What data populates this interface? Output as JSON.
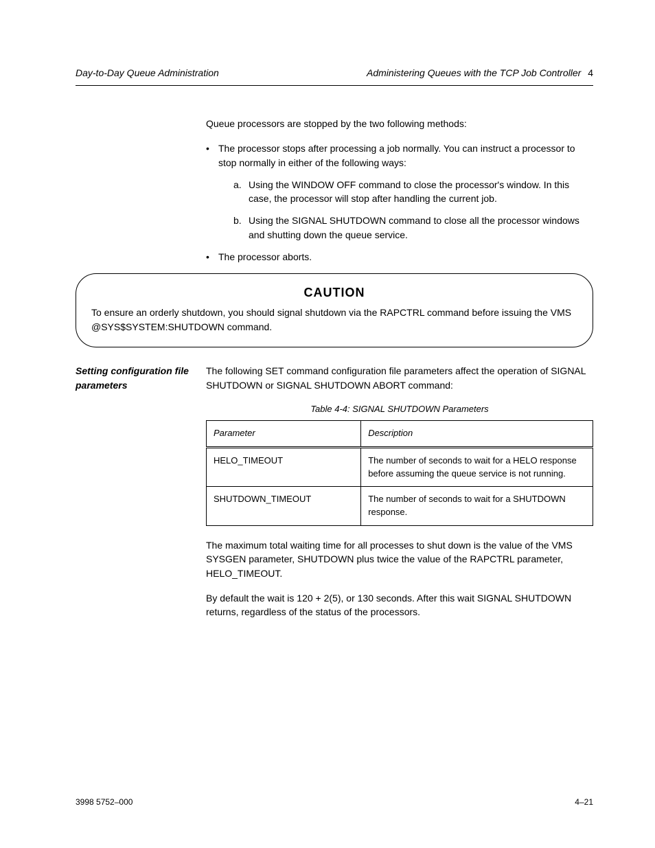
{
  "header": {
    "left": "Day-to-Day Queue Administration",
    "right_italic": "Administering Queues with the TCP Job Controller",
    "right_num": "4"
  },
  "intro": "Queue processors are stopped by the two following methods:",
  "bullets": [
    "The processor stops after processing a job normally. You can instruct a processor to stop normally in either of the following ways:",
    "The processor aborts."
  ],
  "sub_bullets": [
    {
      "mark": "a.",
      "text": "Using the WINDOW OFF command to close the processor's window. In this case, the processor will stop after handling the current job."
    },
    {
      "mark": "b.",
      "text": "Using the SIGNAL SHUTDOWN command to close all the processor windows and shutting down the queue service."
    }
  ],
  "caution": {
    "title": "CAUTION",
    "text": "To ensure an orderly shutdown, you should signal shutdown via the RAPCTRL command before issuing the VMS @SYS$SYSTEM:SHUTDOWN command."
  },
  "section": {
    "left_note": "Setting configuration file parameters",
    "intro": "The following SET command configuration file parameters affect the operation of SIGNAL SHUTDOWN or SIGNAL SHUTDOWN ABORT command:",
    "table_caption": "Table 4-4: SIGNAL SHUTDOWN Parameters",
    "table": {
      "headers": [
        "Parameter",
        "Description"
      ],
      "rows": [
        [
          "HELO_TIMEOUT",
          "The number of seconds to wait for a HELO response before assuming the queue service is not running."
        ],
        [
          "SHUTDOWN_TIMEOUT",
          "The number of seconds to wait for a SHUTDOWN response."
        ]
      ]
    },
    "post_text": "The maximum total waiting time for all processes to shut down is the value of the VMS SYSGEN parameter, SHUTDOWN plus twice the value of the RAPCTRL parameter, HELO_TIMEOUT.",
    "post_text2": "By default the wait is 120 + 2(5), or 130 seconds. After this wait SIGNAL SHUTDOWN returns, regardless of the status of the processors."
  },
  "footer": {
    "left": "3998 5752–000",
    "right": "4–21"
  }
}
